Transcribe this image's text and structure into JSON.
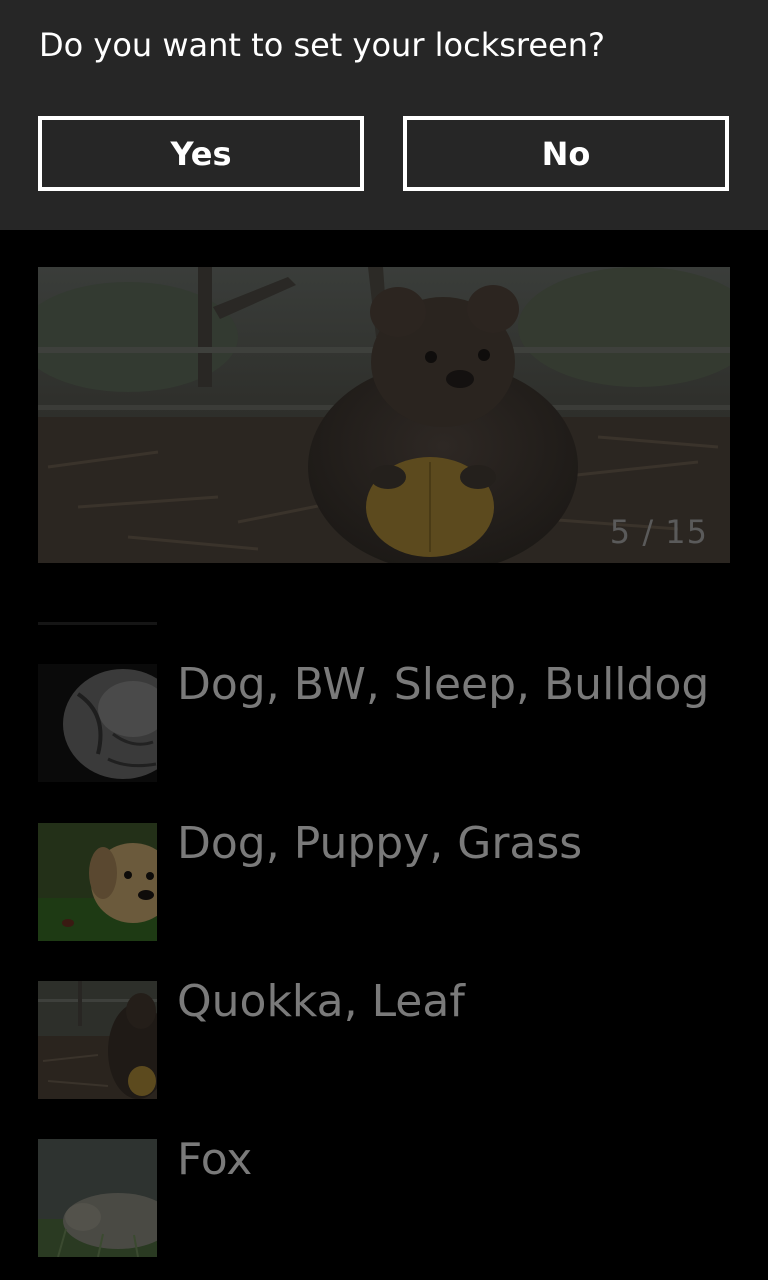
{
  "dialog": {
    "message": "Do you want to set your locksreen?",
    "yes_label": "Yes",
    "no_label": "No"
  },
  "hero": {
    "counter": "5 / 15",
    "image_subject": "quokka holding a leaf"
  },
  "list": {
    "items": [
      {
        "label": "Dog, BW, Sleep, Bulldog",
        "thumb": "bulldog-bw"
      },
      {
        "label": "Dog, Puppy, Grass",
        "thumb": "puppy-grass"
      },
      {
        "label": "Quokka, Leaf",
        "thumb": "quokka-leaf"
      },
      {
        "label": "Fox",
        "thumb": "fox"
      }
    ]
  },
  "colors": {
    "dialog_bg": "#262626",
    "page_bg": "#000000",
    "dimmed_text": "#7a7a7a"
  }
}
